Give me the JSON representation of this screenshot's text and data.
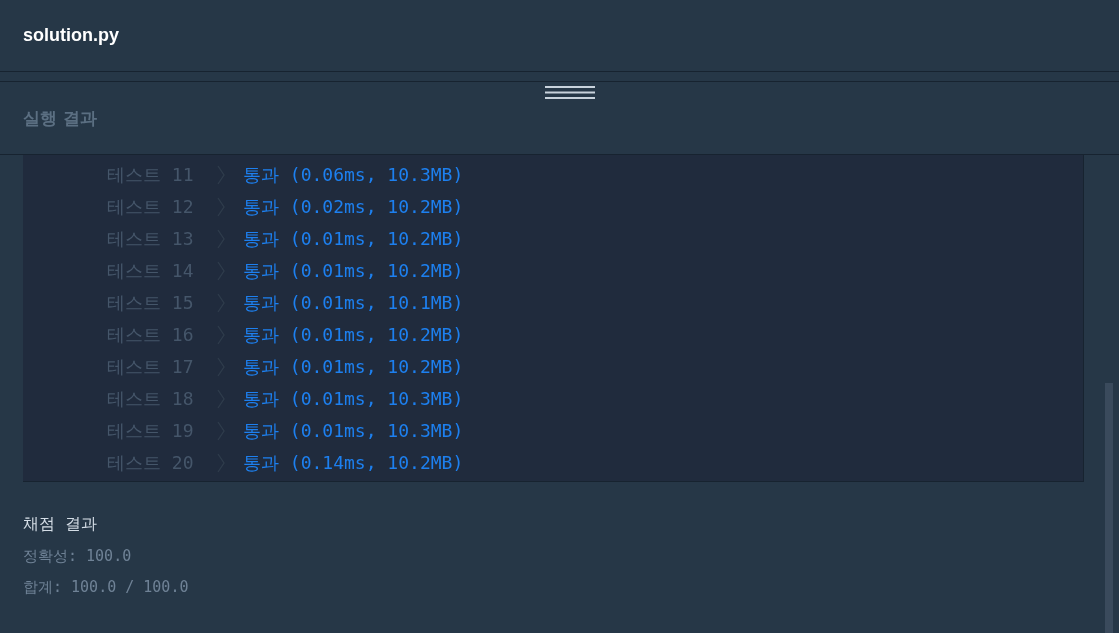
{
  "editor": {
    "filename": "solution.py"
  },
  "results": {
    "title": "실행 결과",
    "tests": [
      {
        "label": "테스트 11",
        "result": "통과 (0.06ms, 10.3MB)"
      },
      {
        "label": "테스트 12",
        "result": "통과 (0.02ms, 10.2MB)"
      },
      {
        "label": "테스트 13",
        "result": "통과 (0.01ms, 10.2MB)"
      },
      {
        "label": "테스트 14",
        "result": "통과 (0.01ms, 10.2MB)"
      },
      {
        "label": "테스트 15",
        "result": "통과 (0.01ms, 10.1MB)"
      },
      {
        "label": "테스트 16",
        "result": "통과 (0.01ms, 10.2MB)"
      },
      {
        "label": "테스트 17",
        "result": "통과 (0.01ms, 10.2MB)"
      },
      {
        "label": "테스트 18",
        "result": "통과 (0.01ms, 10.3MB)"
      },
      {
        "label": "테스트 19",
        "result": "통과 (0.01ms, 10.3MB)"
      },
      {
        "label": "테스트 20",
        "result": "통과 (0.14ms, 10.2MB)"
      }
    ],
    "grading": {
      "title": "채점 결과",
      "lines": [
        "정확성: 100.0",
        "합계: 100.0 / 100.0"
      ]
    }
  }
}
